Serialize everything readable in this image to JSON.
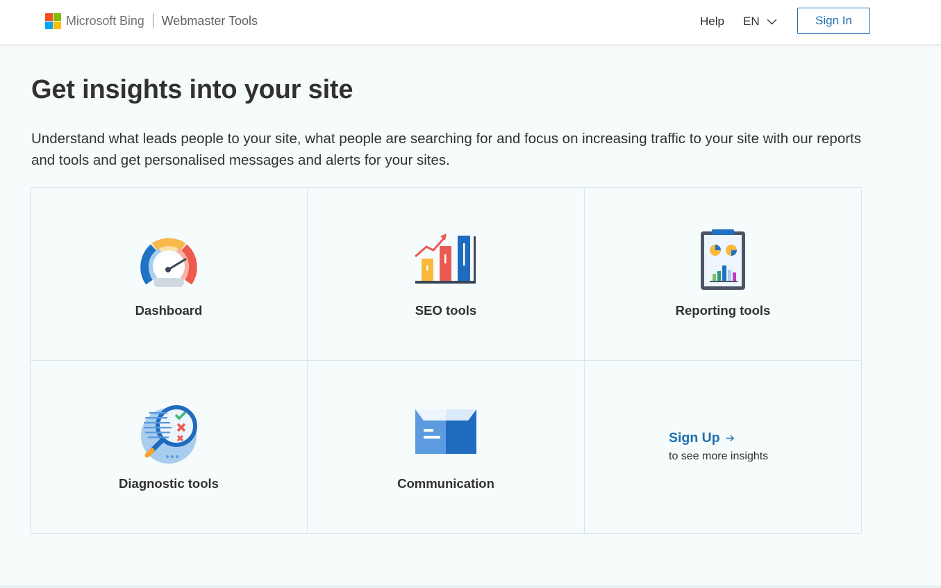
{
  "header": {
    "brand": "Microsoft Bing",
    "product": "Webmaster Tools",
    "help_label": "Help",
    "language": "EN",
    "signin_label": "Sign In"
  },
  "colors": {
    "accent": "#1f6fb2",
    "ms_red": "#f25022",
    "ms_green": "#7fba00",
    "ms_blue": "#00a4ef",
    "ms_yellow": "#ffb900"
  },
  "main": {
    "title": "Get insights into your site",
    "description": "Understand what leads people to your site, what people are searching for and focus on increasing traffic to your site with our reports and tools and get personalised messages and alerts for your sites.",
    "tiles": [
      {
        "label": "Dashboard",
        "icon": "speedometer-icon"
      },
      {
        "label": "SEO tools",
        "icon": "bar-chart-growth-icon"
      },
      {
        "label": "Reporting tools",
        "icon": "clipboard-report-icon"
      },
      {
        "label": "Diagnostic tools",
        "icon": "magnifier-checklist-icon"
      },
      {
        "label": "Communication",
        "icon": "envelope-icon"
      }
    ],
    "signup": {
      "link_label": "Sign Up",
      "subtext": "to see more insights"
    }
  }
}
